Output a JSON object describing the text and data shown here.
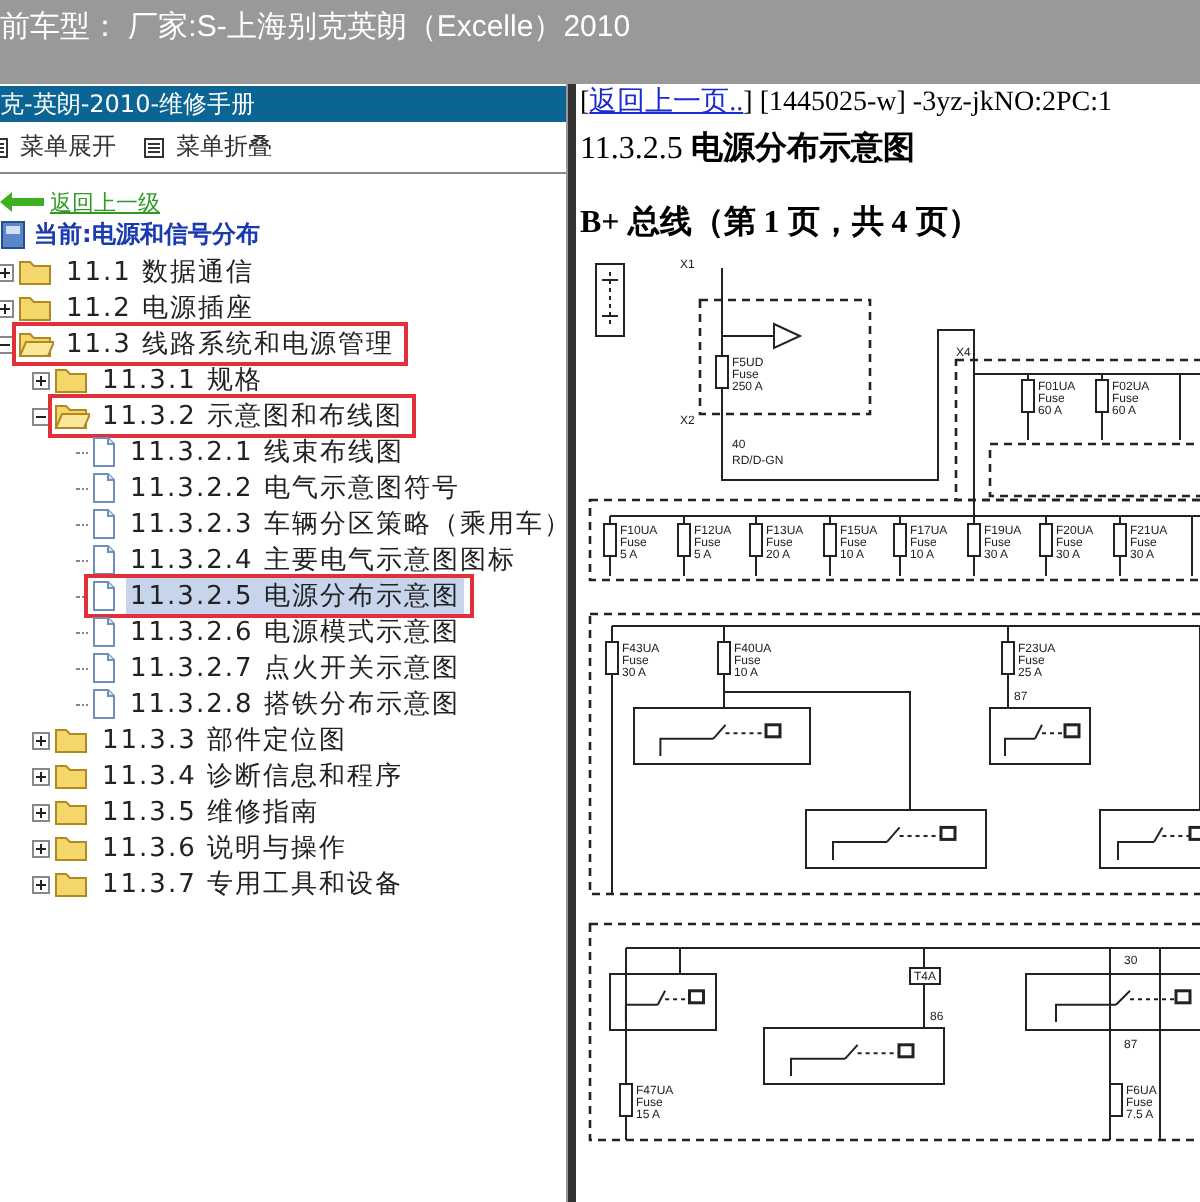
{
  "title_bar": {
    "text": "前车型： 厂家:S-上海别克英朗（Excelle）2010"
  },
  "sidebar": {
    "header": "克-英朗-2010-维修手册",
    "toolbar": [
      {
        "label": "菜单展开"
      },
      {
        "label": "菜单折叠"
      }
    ],
    "back_link": "返回上一级",
    "current": "当前:电源和信号分布",
    "tree": [
      {
        "label": "11.1 数据通信",
        "kind": "folder",
        "expanded": false,
        "marked": false,
        "selected": false
      },
      {
        "label": "11.2 电源插座",
        "kind": "folder",
        "expanded": false,
        "marked": false,
        "selected": false
      },
      {
        "label": "11.3 线路系统和电源管理",
        "kind": "folder",
        "expanded": true,
        "marked": true,
        "selected": false,
        "children": [
          {
            "label": "11.3.1 规格",
            "kind": "folder",
            "expanded": false,
            "marked": false,
            "selected": false
          },
          {
            "label": "11.3.2 示意图和布线图",
            "kind": "folder",
            "expanded": true,
            "marked": true,
            "selected": false,
            "children": [
              {
                "label": "11.3.2.1 线束布线图",
                "kind": "doc",
                "marked": false,
                "selected": false
              },
              {
                "label": "11.3.2.2 电气示意图符号",
                "kind": "doc",
                "marked": false,
                "selected": false
              },
              {
                "label": "11.3.2.3 车辆分区策略（乘用车）",
                "kind": "doc",
                "marked": false,
                "selected": false
              },
              {
                "label": "11.3.2.4 主要电气示意图图标",
                "kind": "doc",
                "marked": false,
                "selected": false
              },
              {
                "label": "11.3.2.5 电源分布示意图",
                "kind": "doc",
                "marked": true,
                "selected": true
              },
              {
                "label": "11.3.2.6 电源模式示意图",
                "kind": "doc",
                "marked": false,
                "selected": false
              },
              {
                "label": "11.3.2.7 点火开关示意图",
                "kind": "doc",
                "marked": false,
                "selected": false
              },
              {
                "label": "11.3.2.8 搭铁分布示意图",
                "kind": "doc",
                "marked": false,
                "selected": false
              }
            ]
          },
          {
            "label": "11.3.3 部件定位图",
            "kind": "folder",
            "expanded": false,
            "marked": false,
            "selected": false
          },
          {
            "label": "11.3.4 诊断信息和程序",
            "kind": "folder",
            "expanded": false,
            "marked": false,
            "selected": false
          },
          {
            "label": "11.3.5 维修指南",
            "kind": "folder",
            "expanded": false,
            "marked": false,
            "selected": false
          },
          {
            "label": "11.3.6 说明与操作",
            "kind": "folder",
            "expanded": false,
            "marked": false,
            "selected": false
          },
          {
            "label": "11.3.7 专用工具和设备",
            "kind": "folder",
            "expanded": false,
            "marked": false,
            "selected": false
          }
        ]
      }
    ]
  },
  "content": {
    "link_prefix": "[",
    "back_link": "返回上一页..",
    "page_info": "] [1445025-w] -3yz-jkNO:2PC:1",
    "heading": "11.3.2.5 **电源分布示意图**",
    "subtitle": "B+ 总线（第 1 页，共 4 页）",
    "diagram": {
      "fuses": [
        {
          "name": "F5UD",
          "type": "Fuse",
          "rating": "250 A"
        },
        {
          "name": "F01UA",
          "type": "Fuse",
          "rating": "60 A"
        },
        {
          "name": "F02UA",
          "type": "Fuse",
          "rating": "60 A"
        },
        {
          "name": "F10UA",
          "type": "Fuse",
          "rating": "5 A"
        },
        {
          "name": "F12UA",
          "type": "Fuse",
          "rating": "5 A"
        },
        {
          "name": "F13UA",
          "type": "Fuse",
          "rating": "20 A"
        },
        {
          "name": "F15UA",
          "type": "Fuse",
          "rating": "10 A"
        },
        {
          "name": "F17UA",
          "type": "Fuse",
          "rating": "10 A"
        },
        {
          "name": "F19UA",
          "type": "Fuse",
          "rating": "30 A"
        },
        {
          "name": "F20UA",
          "type": "Fuse",
          "rating": "30 A"
        },
        {
          "name": "F21UA",
          "type": "Fuse",
          "rating": "30 A"
        },
        {
          "name": "F43UA",
          "type": "Fuse",
          "rating": "30 A"
        },
        {
          "name": "F40UA",
          "type": "Fuse",
          "rating": "10 A"
        },
        {
          "name": "F23UA",
          "type": "Fuse",
          "rating": "25 A"
        },
        {
          "name": "F47UA",
          "type": "Fuse",
          "rating": "15 A"
        },
        {
          "name": "F6UA",
          "type": "Fuse",
          "rating": "7.5 A"
        }
      ],
      "labels": [
        "X1",
        "X2",
        "X4",
        "40",
        "RD/D-GN",
        "87",
        "T4A",
        "86",
        "30",
        "87"
      ]
    }
  }
}
